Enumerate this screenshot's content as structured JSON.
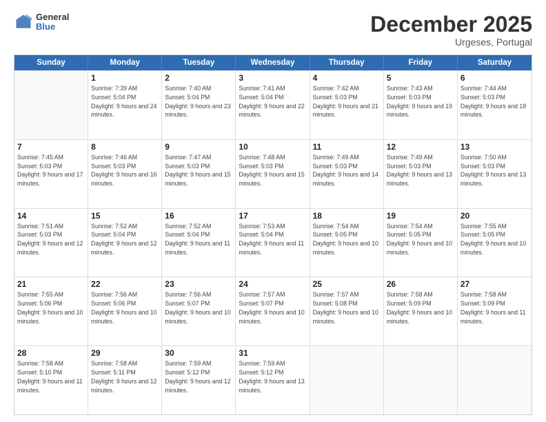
{
  "header": {
    "logo_general": "General",
    "logo_blue": "Blue",
    "month_title": "December 2025",
    "subtitle": "Urgeses, Portugal"
  },
  "calendar": {
    "days_of_week": [
      "Sunday",
      "Monday",
      "Tuesday",
      "Wednesday",
      "Thursday",
      "Friday",
      "Saturday"
    ],
    "weeks": [
      [
        {
          "day": "",
          "sunrise": "",
          "sunset": "",
          "daylight": ""
        },
        {
          "day": "1",
          "sunrise": "Sunrise: 7:39 AM",
          "sunset": "Sunset: 5:04 PM",
          "daylight": "Daylight: 9 hours and 24 minutes."
        },
        {
          "day": "2",
          "sunrise": "Sunrise: 7:40 AM",
          "sunset": "Sunset: 5:04 PM",
          "daylight": "Daylight: 9 hours and 23 minutes."
        },
        {
          "day": "3",
          "sunrise": "Sunrise: 7:41 AM",
          "sunset": "Sunset: 5:04 PM",
          "daylight": "Daylight: 9 hours and 22 minutes."
        },
        {
          "day": "4",
          "sunrise": "Sunrise: 7:42 AM",
          "sunset": "Sunset: 5:03 PM",
          "daylight": "Daylight: 9 hours and 21 minutes."
        },
        {
          "day": "5",
          "sunrise": "Sunrise: 7:43 AM",
          "sunset": "Sunset: 5:03 PM",
          "daylight": "Daylight: 9 hours and 19 minutes."
        },
        {
          "day": "6",
          "sunrise": "Sunrise: 7:44 AM",
          "sunset": "Sunset: 5:03 PM",
          "daylight": "Daylight: 9 hours and 18 minutes."
        }
      ],
      [
        {
          "day": "7",
          "sunrise": "Sunrise: 7:45 AM",
          "sunset": "Sunset: 5:03 PM",
          "daylight": "Daylight: 9 hours and 17 minutes."
        },
        {
          "day": "8",
          "sunrise": "Sunrise: 7:46 AM",
          "sunset": "Sunset: 5:03 PM",
          "daylight": "Daylight: 9 hours and 16 minutes."
        },
        {
          "day": "9",
          "sunrise": "Sunrise: 7:47 AM",
          "sunset": "Sunset: 5:03 PM",
          "daylight": "Daylight: 9 hours and 15 minutes."
        },
        {
          "day": "10",
          "sunrise": "Sunrise: 7:48 AM",
          "sunset": "Sunset: 5:03 PM",
          "daylight": "Daylight: 9 hours and 15 minutes."
        },
        {
          "day": "11",
          "sunrise": "Sunrise: 7:49 AM",
          "sunset": "Sunset: 5:03 PM",
          "daylight": "Daylight: 9 hours and 14 minutes."
        },
        {
          "day": "12",
          "sunrise": "Sunrise: 7:49 AM",
          "sunset": "Sunset: 5:03 PM",
          "daylight": "Daylight: 9 hours and 13 minutes."
        },
        {
          "day": "13",
          "sunrise": "Sunrise: 7:50 AM",
          "sunset": "Sunset: 5:03 PM",
          "daylight": "Daylight: 9 hours and 13 minutes."
        }
      ],
      [
        {
          "day": "14",
          "sunrise": "Sunrise: 7:51 AM",
          "sunset": "Sunset: 5:03 PM",
          "daylight": "Daylight: 9 hours and 12 minutes."
        },
        {
          "day": "15",
          "sunrise": "Sunrise: 7:52 AM",
          "sunset": "Sunset: 5:04 PM",
          "daylight": "Daylight: 9 hours and 12 minutes."
        },
        {
          "day": "16",
          "sunrise": "Sunrise: 7:52 AM",
          "sunset": "Sunset: 5:04 PM",
          "daylight": "Daylight: 9 hours and 11 minutes."
        },
        {
          "day": "17",
          "sunrise": "Sunrise: 7:53 AM",
          "sunset": "Sunset: 5:04 PM",
          "daylight": "Daylight: 9 hours and 11 minutes."
        },
        {
          "day": "18",
          "sunrise": "Sunrise: 7:54 AM",
          "sunset": "Sunset: 5:05 PM",
          "daylight": "Daylight: 9 hours and 10 minutes."
        },
        {
          "day": "19",
          "sunrise": "Sunrise: 7:54 AM",
          "sunset": "Sunset: 5:05 PM",
          "daylight": "Daylight: 9 hours and 10 minutes."
        },
        {
          "day": "20",
          "sunrise": "Sunrise: 7:55 AM",
          "sunset": "Sunset: 5:05 PM",
          "daylight": "Daylight: 9 hours and 10 minutes."
        }
      ],
      [
        {
          "day": "21",
          "sunrise": "Sunrise: 7:55 AM",
          "sunset": "Sunset: 5:06 PM",
          "daylight": "Daylight: 9 hours and 10 minutes."
        },
        {
          "day": "22",
          "sunrise": "Sunrise: 7:56 AM",
          "sunset": "Sunset: 5:06 PM",
          "daylight": "Daylight: 9 hours and 10 minutes."
        },
        {
          "day": "23",
          "sunrise": "Sunrise: 7:56 AM",
          "sunset": "Sunset: 5:07 PM",
          "daylight": "Daylight: 9 hours and 10 minutes."
        },
        {
          "day": "24",
          "sunrise": "Sunrise: 7:57 AM",
          "sunset": "Sunset: 5:07 PM",
          "daylight": "Daylight: 9 hours and 10 minutes."
        },
        {
          "day": "25",
          "sunrise": "Sunrise: 7:57 AM",
          "sunset": "Sunset: 5:08 PM",
          "daylight": "Daylight: 9 hours and 10 minutes."
        },
        {
          "day": "26",
          "sunrise": "Sunrise: 7:58 AM",
          "sunset": "Sunset: 5:09 PM",
          "daylight": "Daylight: 9 hours and 10 minutes."
        },
        {
          "day": "27",
          "sunrise": "Sunrise: 7:58 AM",
          "sunset": "Sunset: 5:09 PM",
          "daylight": "Daylight: 9 hours and 11 minutes."
        }
      ],
      [
        {
          "day": "28",
          "sunrise": "Sunrise: 7:58 AM",
          "sunset": "Sunset: 5:10 PM",
          "daylight": "Daylight: 9 hours and 11 minutes."
        },
        {
          "day": "29",
          "sunrise": "Sunrise: 7:58 AM",
          "sunset": "Sunset: 5:11 PM",
          "daylight": "Daylight: 9 hours and 12 minutes."
        },
        {
          "day": "30",
          "sunrise": "Sunrise: 7:59 AM",
          "sunset": "Sunset: 5:12 PM",
          "daylight": "Daylight: 9 hours and 12 minutes."
        },
        {
          "day": "31",
          "sunrise": "Sunrise: 7:59 AM",
          "sunset": "Sunset: 5:12 PM",
          "daylight": "Daylight: 9 hours and 13 minutes."
        },
        {
          "day": "",
          "sunrise": "",
          "sunset": "",
          "daylight": ""
        },
        {
          "day": "",
          "sunrise": "",
          "sunset": "",
          "daylight": ""
        },
        {
          "day": "",
          "sunrise": "",
          "sunset": "",
          "daylight": ""
        }
      ]
    ]
  }
}
